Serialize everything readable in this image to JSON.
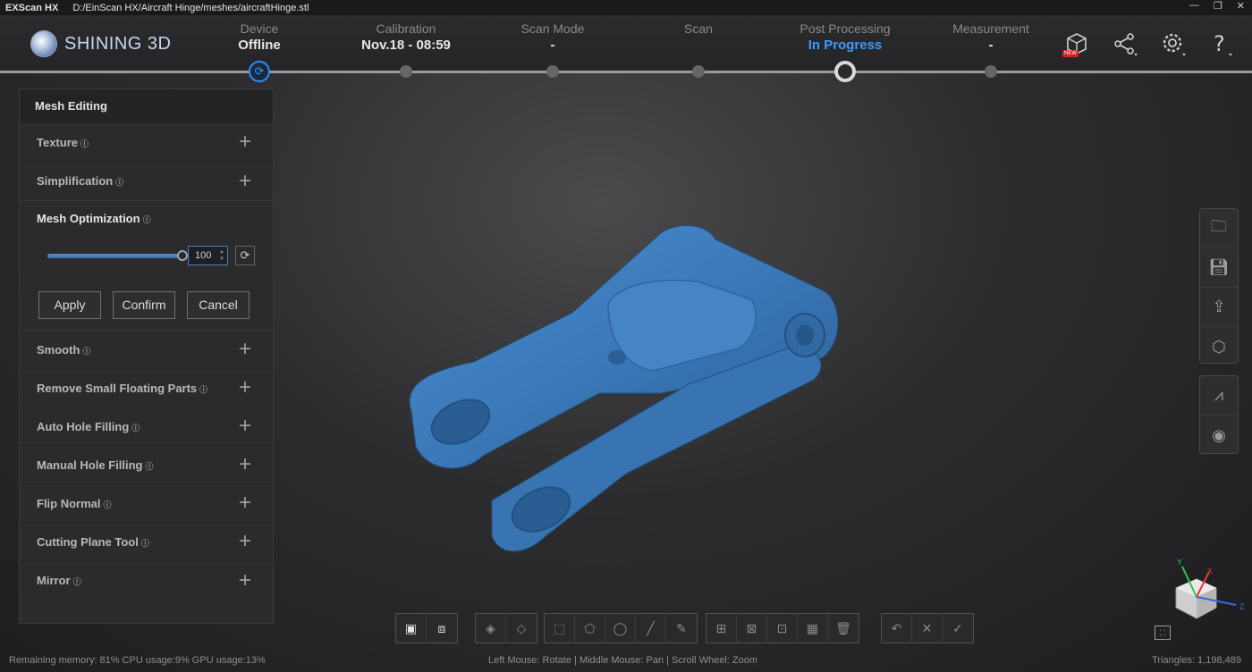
{
  "titlebar": {
    "app_name": "EXScan HX",
    "file_path": "D:/EinScan HX/Aircraft Hinge/meshes/aircraftHinge.stl",
    "min_icon": "—",
    "max_icon": "❐",
    "close_icon": "✕"
  },
  "logo": {
    "text": "SHINING 3D"
  },
  "steps": [
    {
      "label": "Device",
      "value": "Offline"
    },
    {
      "label": "Calibration",
      "value": "Nov.18 - 08:59"
    },
    {
      "label": "Scan Mode",
      "value": "-"
    },
    {
      "label": "Scan",
      "value": ""
    },
    {
      "label": "Post Processing",
      "value": "In Progress"
    },
    {
      "label": "Measurement",
      "value": "-"
    }
  ],
  "header_icons": {
    "new_badge": "NEW"
  },
  "panel": {
    "title": "Mesh Editing",
    "items_top": [
      {
        "label": "Texture"
      },
      {
        "label": "Simplification"
      }
    ],
    "mesh_optimization": {
      "title": "Mesh Optimization",
      "slider_value": "100",
      "slider_fraction": 1.0,
      "apply": "Apply",
      "confirm": "Confirm",
      "cancel": "Cancel"
    },
    "items_bottom": [
      {
        "label": "Smooth"
      },
      {
        "label": "Remove Small Floating Parts"
      },
      {
        "label": "Auto Hole Filling"
      },
      {
        "label": "Manual Hole Filling"
      },
      {
        "label": "Flip Normal"
      },
      {
        "label": "Cutting Plane Tool"
      },
      {
        "label": "Mirror"
      }
    ]
  },
  "axis": {
    "x": "X",
    "y": "Y",
    "z": "Z"
  },
  "status": {
    "left": "Remaining memory: 81% CPU usage:9%  GPU usage:13%",
    "center": "Left Mouse: Rotate | Middle Mouse: Pan | Scroll Wheel: Zoom",
    "right": "Triangles: 1,198,489"
  },
  "colors": {
    "accent": "#3a9cff",
    "model": "#3a78b8"
  }
}
